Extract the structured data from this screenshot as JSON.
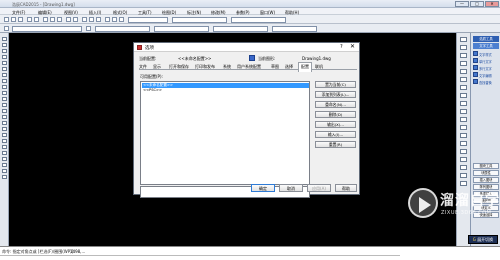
{
  "window": {
    "title": "浩辰CAD2015 - [Drawing1.dwg]",
    "controls": [
      "—",
      "□",
      "✕"
    ]
  },
  "menu": [
    "文件(F)",
    "编辑(E)",
    "视图(V)",
    "插入(I)",
    "格式(O)",
    "工具(T)",
    "绘图(D)",
    "标注(N)",
    "修改(M)",
    "参数(P)",
    "窗口(W)",
    "帮助(H)"
  ],
  "dialog": {
    "title": "选项",
    "help": "?",
    "close": "✕",
    "current_profile_label": "当前配置:",
    "current_profile_value": "<<未命名配置>>",
    "current_drawing_label": "当前图形:",
    "current_drawing_value": "Drawing1.dwg",
    "tabs": [
      "文件",
      "显示",
      "打开和保存",
      "打印和发布",
      "系统",
      "用户系统配置",
      "草图",
      "选择",
      "配置",
      "联机"
    ],
    "active_tab_index": 8,
    "profiles_label": "可用配置(P):",
    "profiles": [
      "<<未命名配置>>",
      "<<PSC>>"
    ],
    "side_buttons": [
      "置为当前(C)",
      "添加到列表(L)...",
      "重命名(N)...",
      "删除(D)",
      "输出(X)...",
      "输入(I)...",
      "重置(R)"
    ],
    "footer_buttons": {
      "ok": "确定",
      "cancel": "取消",
      "apply": "应用(A)",
      "help": "帮助"
    }
  },
  "right_panel": {
    "header1": "浩辰工具",
    "header2": "文字工具",
    "items": [
      "文字样式",
      "单行文字",
      "多行文字",
      "文字编辑",
      "查找替换"
    ],
    "buttons": [
      "图块工具",
      "块属性",
      "插入图块",
      "阵列图块",
      "多重插入",
      "块编辑",
      "块定义",
      "快速选择"
    ]
  },
  "command": {
    "prompt": "命令: 指定对角点或 [栏选(F)/圈围(WP)]:",
    "value": "1498,..."
  },
  "cursor_label": {
    "prefix": "G",
    "text": "展开切换"
  },
  "watermark": {
    "brand": "溜溜自学",
    "url": "ZIXUE.3D66.COM"
  }
}
